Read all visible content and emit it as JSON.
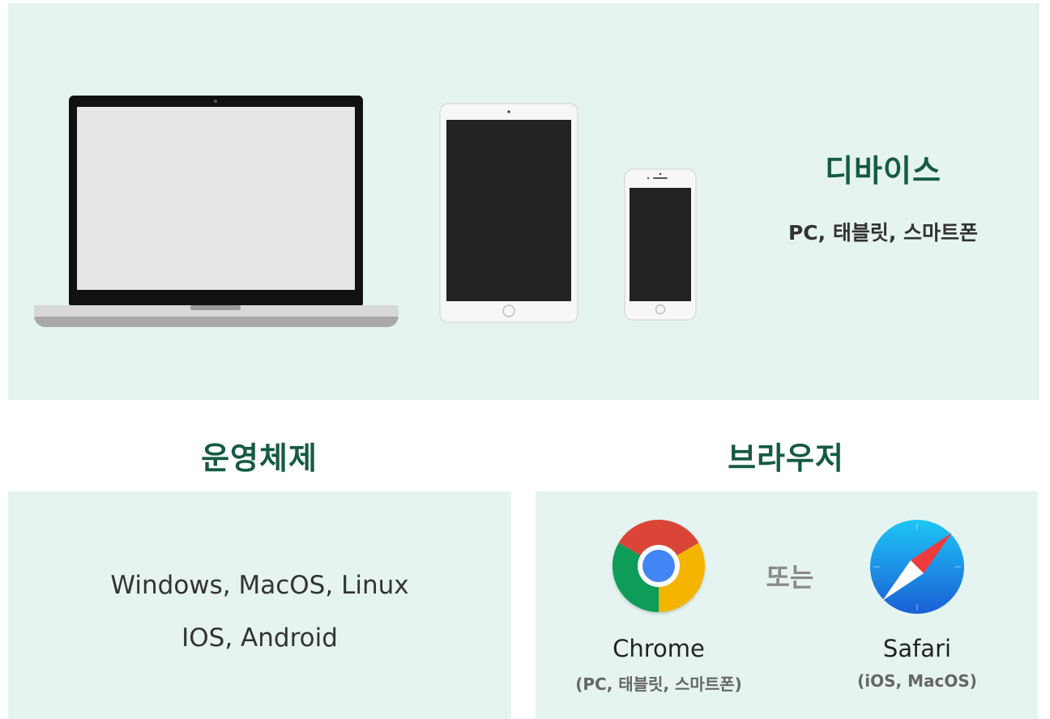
{
  "devices": {
    "title": "디바이스",
    "subtitle": "PC, 태블릿, 스마트폰",
    "icons": [
      "laptop-icon",
      "tablet-icon",
      "smartphone-icon"
    ]
  },
  "os": {
    "title": "운영체제",
    "lines": [
      "Windows, MacOS, Linux",
      "IOS, Android"
    ]
  },
  "browser": {
    "title": "브라우저",
    "or_label": "또는",
    "items": [
      {
        "name": "Chrome",
        "note": "(PC, 태블릿, 스마트폰)",
        "icon": "chrome-icon"
      },
      {
        "name": "Safari",
        "note": "(iOS, MacOS)",
        "icon": "safari-icon"
      }
    ]
  },
  "colors": {
    "panel_bg": "#e5f4f0",
    "title_green": "#155a45",
    "text_dark": "#333333",
    "text_gray": "#666666"
  }
}
